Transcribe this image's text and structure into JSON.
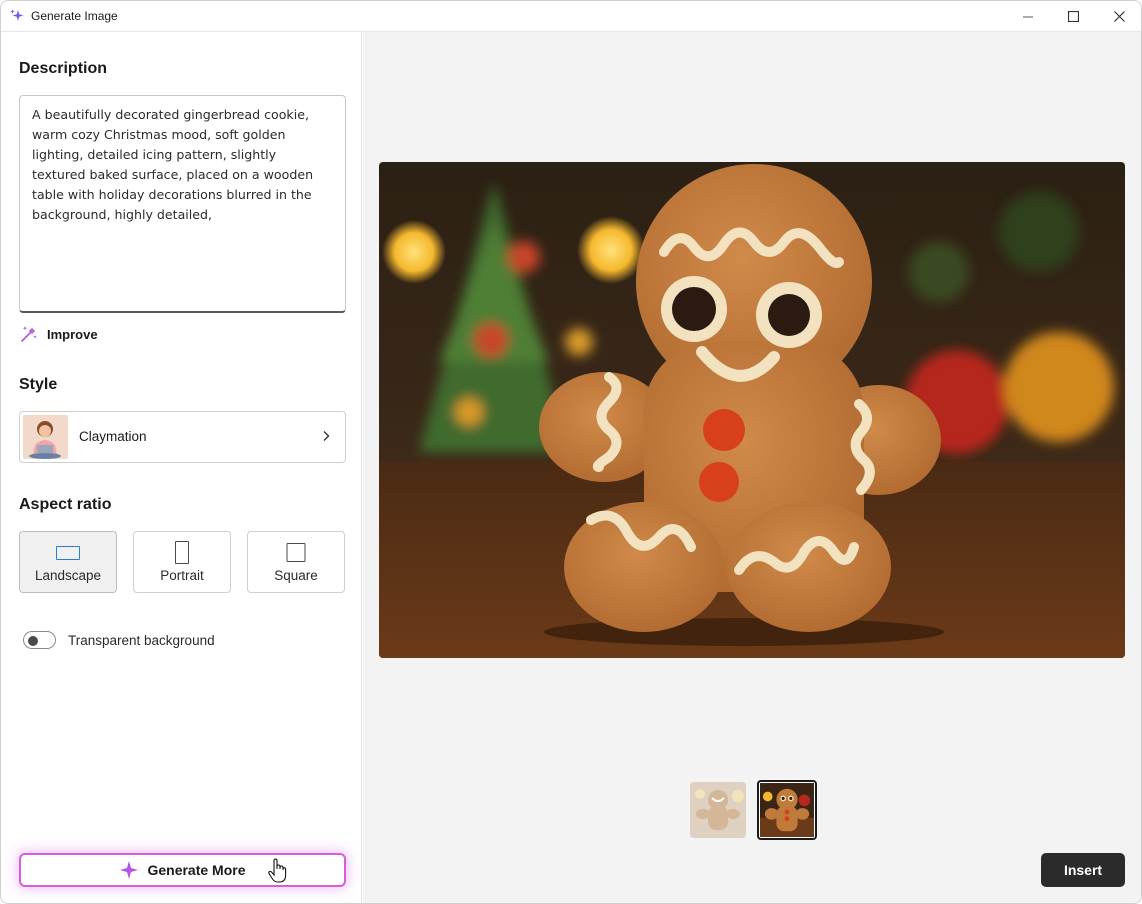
{
  "window": {
    "title": "Generate Image",
    "controls": [
      "minimize-icon",
      "maximize-icon",
      "close-icon"
    ]
  },
  "description": {
    "heading": "Description",
    "text": "A beautifully decorated gingerbread cookie, warm cozy Christmas mood, soft golden lighting, detailed icing pattern, slightly textured baked surface, placed on a wooden table with holiday decorations blurred in the background, highly detailed,",
    "improve_label": "Improve"
  },
  "style": {
    "heading": "Style",
    "selected": "Claymation"
  },
  "aspect_ratio": {
    "heading": "Aspect ratio",
    "options": [
      {
        "label": "Landscape",
        "selected": true
      },
      {
        "label": "Portrait",
        "selected": false
      },
      {
        "label": "Square",
        "selected": false
      }
    ]
  },
  "transparent_background": {
    "label": "Transparent background",
    "enabled": false
  },
  "actions": {
    "generate_more": "Generate More",
    "insert": "Insert"
  },
  "colors": {
    "accent_gradient": [
      "#8a5cf6",
      "#e04ad9"
    ],
    "insert_bg": "#2b2b2b"
  }
}
